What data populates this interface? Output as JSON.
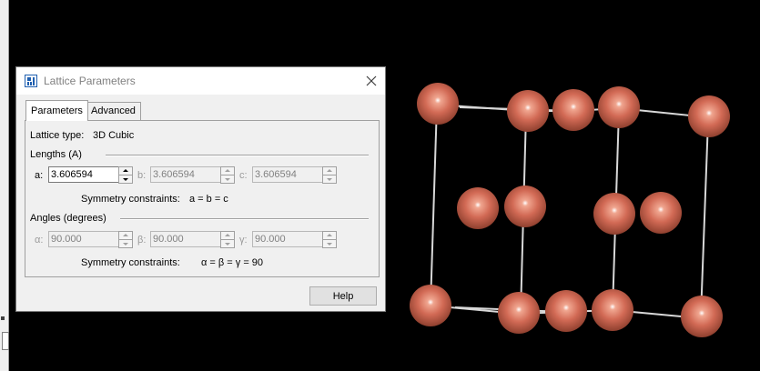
{
  "dialog": {
    "title": "Lattice Parameters",
    "icons": {
      "app": "lattice-app-icon",
      "close": "close-icon"
    }
  },
  "tabs": [
    {
      "label": "Parameters",
      "active": true
    },
    {
      "label": "Advanced",
      "active": false
    }
  ],
  "lattice": {
    "type_label": "Lattice type:",
    "type_value": "3D Cubic"
  },
  "lengths": {
    "heading": "Lengths (A)",
    "fields": [
      {
        "symbol": "a:",
        "value": "3.606594",
        "enabled": true
      },
      {
        "symbol": "b:",
        "value": "3.606594",
        "enabled": false
      },
      {
        "symbol": "c:",
        "value": "3.606594",
        "enabled": false
      }
    ],
    "constraints_label": "Symmetry constraints:",
    "constraints_value": "a = b = c"
  },
  "angles": {
    "heading": "Angles (degrees)",
    "fields": [
      {
        "symbol": "α:",
        "value": "90.000",
        "enabled": false
      },
      {
        "symbol": "β:",
        "value": "90.000",
        "enabled": false
      },
      {
        "symbol": "γ:",
        "value": "90.000",
        "enabled": false
      }
    ],
    "constraints_label": "Symmetry constraints:",
    "constraints_value": "α = β = γ = 90"
  },
  "buttons": {
    "help": "Help"
  },
  "viewer": {
    "background": "#000000",
    "atom_color": "#d26a55",
    "bond_color": "#d8d8d8"
  }
}
